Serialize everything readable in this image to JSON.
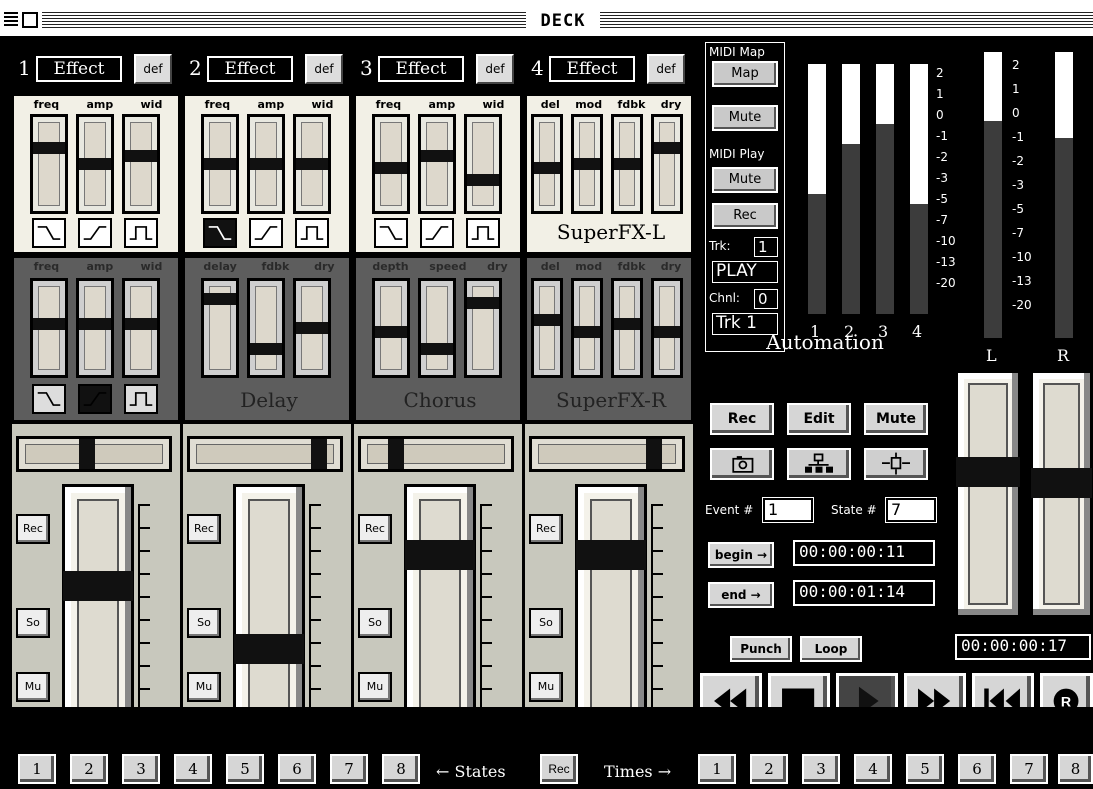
{
  "window": {
    "title": "DECK"
  },
  "channels": [
    {
      "number": "1",
      "effect_label": "Effect",
      "def_label": "def",
      "top_params": [
        "freq",
        "amp",
        "wid"
      ],
      "top_levels": [
        0.3,
        0.5,
        0.4
      ],
      "mid_params": [
        "freq",
        "amp",
        "wid"
      ],
      "mid_levels": [
        0.45,
        0.45,
        0.45
      ],
      "mid_name": "",
      "pan_level": 0.45,
      "fader_level": 0.6,
      "rec_label": "Rec",
      "solo_label": "So",
      "mute_label": "Mu"
    },
    {
      "number": "2",
      "effect_label": "Effect",
      "def_label": "def",
      "top_params": [
        "freq",
        "amp",
        "wid"
      ],
      "top_levels": [
        0.5,
        0.5,
        0.5
      ],
      "mid_params": [
        "delay",
        "fdbk",
        "dry"
      ],
      "mid_levels": [
        0.15,
        0.75,
        0.5
      ],
      "mid_name": "Delay",
      "pan_level": 0.9,
      "fader_level": 0.3,
      "rec_label": "Rec",
      "solo_label": "So",
      "mute_label": "Mu"
    },
    {
      "number": "3",
      "effect_label": "Effect",
      "def_label": "def",
      "top_params": [
        "freq",
        "amp",
        "wid"
      ],
      "top_levels": [
        0.55,
        0.4,
        0.7
      ],
      "mid_params": [
        "depth",
        "speed",
        "dry"
      ],
      "mid_levels": [
        0.55,
        0.75,
        0.2
      ],
      "mid_name": "Chorus",
      "pan_level": 0.2,
      "fader_level": 0.75,
      "rec_label": "Rec",
      "solo_label": "So",
      "mute_label": "Mu"
    },
    {
      "number": "4",
      "effect_label": "Effect",
      "def_label": "def",
      "top_params": [
        "del",
        "mod",
        "fdbk",
        "dry"
      ],
      "top_levels": [
        0.55,
        0.5,
        0.5,
        0.3
      ],
      "top_name": "SuperFX-L",
      "mid_params": [
        "del",
        "mod",
        "fdbk",
        "dry"
      ],
      "mid_levels": [
        0.4,
        0.55,
        0.45,
        0.55
      ],
      "mid_name": "SuperFX-R",
      "pan_level": 0.85,
      "fader_level": 0.75,
      "rec_label": "Rec",
      "solo_label": "So",
      "mute_label": "Mu"
    }
  ],
  "midi": {
    "map_title": "MIDI Map",
    "map_button": "Map",
    "map_mute": "Mute",
    "play_title": "MIDI Play",
    "play_mute": "Mute",
    "play_rec": "Rec",
    "trk_label": "Trk:",
    "trk_value": "1",
    "status": "PLAY",
    "chnl_label": "Chnl:",
    "chnl_value": "0",
    "track_name": "Trk 1"
  },
  "meters": {
    "channel_labels": [
      "1",
      "2",
      "3",
      "4"
    ],
    "channel_levels": [
      0.52,
      0.32,
      0.24,
      0.56
    ],
    "channel_scale": [
      "2",
      "1",
      "0",
      "-1",
      "-2",
      "-3",
      "-5",
      "-7",
      "-10",
      "-13",
      "-20"
    ],
    "master_labels": [
      "L",
      "R"
    ],
    "master_levels": [
      0.76,
      0.7
    ],
    "master_scale": [
      "2",
      "1",
      "0",
      "-1",
      "-2",
      "-3",
      "-5",
      "-7",
      "-10",
      "-13",
      "-20"
    ]
  },
  "automation": {
    "title": "Automation",
    "rec": "Rec",
    "edit": "Edit",
    "mute": "Mute",
    "icons": [
      "snapshot-icon",
      "hierarchy-icon",
      "expand-icon"
    ],
    "event_label": "Event #",
    "event_value": "1",
    "state_label": "State #",
    "state_value": "7",
    "begin_label": "begin →",
    "begin_time": "00:00:00:11",
    "end_label": "end →",
    "end_time": "00:00:01:14",
    "punch": "Punch",
    "loop": "Loop",
    "current_time": "00:00:00:17",
    "master_fader_levels": [
      0.4,
      0.45
    ]
  },
  "transport": {
    "buttons": [
      "rewind-icon",
      "stop-icon",
      "play-icon",
      "fast-forward-icon",
      "return-to-start-icon",
      "record-icon"
    ],
    "record_glyph": "R"
  },
  "bottom": {
    "states": [
      "1",
      "2",
      "3",
      "4",
      "5",
      "6",
      "7",
      "8"
    ],
    "states_label": "← States",
    "rec_label": "Rec",
    "times_label": "Times →",
    "times": [
      "1",
      "2",
      "3",
      "4",
      "5",
      "6",
      "7",
      "8"
    ]
  }
}
